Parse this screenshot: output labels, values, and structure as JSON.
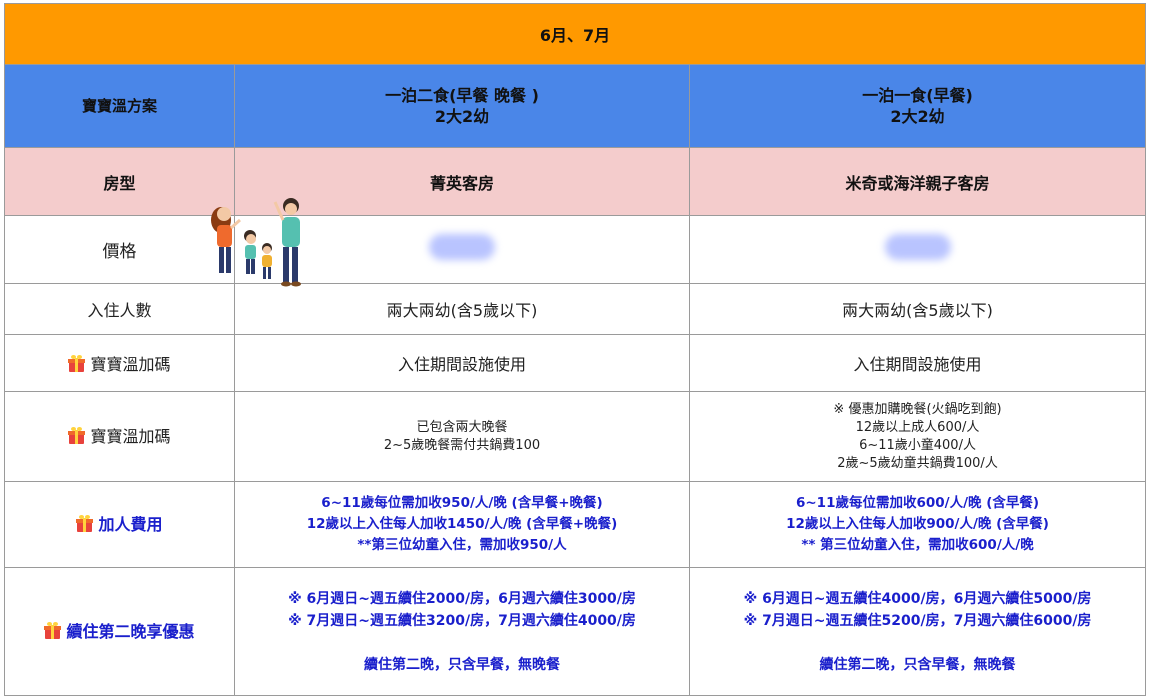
{
  "header": {
    "title": "6月、7月"
  },
  "plan_row": {
    "label": "寶寶溫方案",
    "col1": {
      "line1": "一泊二食(早餐 晚餐 )",
      "line2": "2大2幼"
    },
    "col2": {
      "line1": "一泊一食(早餐)",
      "line2": "2大2幼"
    }
  },
  "room_row": {
    "label": "房型",
    "col1": "菁英客房",
    "col2": "米奇或海洋親子客房"
  },
  "price_row": {
    "label": "價格",
    "col1_icon": "blurred-price",
    "col2_icon": "blurred-price"
  },
  "people_row": {
    "label": "入住人數",
    "col1": "兩大兩幼(含5歲以下)",
    "col2": "兩大兩幼(含5歲以下)"
  },
  "perk_row1": {
    "label": "寶寶溫加碼",
    "icon": "gift-icon",
    "col1": "入住期間設施使用",
    "col2": "入住期間設施使用"
  },
  "perk_row2": {
    "label": "寶寶溫加碼",
    "icon": "gift-icon",
    "col1": [
      "已包含兩大晚餐",
      "2~5歲晚餐需付共鍋費100"
    ],
    "col2": [
      "※ 優惠加購晚餐(火鍋吃到飽)",
      "12歲以上成人600/人",
      "6~11歲小童400/人",
      "2歲~5歲幼童共鍋費100/人"
    ]
  },
  "extra_row": {
    "label": "加人費用",
    "icon": "gift-icon",
    "col1": [
      "6~11歲每位需加收950/人/晚 (含早餐+晚餐)",
      "12歲以上入住每人加收1450/人/晚  (含早餐+晚餐)",
      "**第三位幼童入住，需加收950/人"
    ],
    "col2": [
      "6~11歲每位需加收600/人/晚 (含早餐)",
      "12歲以上入住每人加收900/人/晚 (含早餐)",
      "** 第三位幼童入住，需加收600/人/晚"
    ]
  },
  "stay_row": {
    "label": "續住第二晚享優惠",
    "icon": "gift-icon",
    "col1": [
      "※ 6月週日~週五續住2000/房，6月週六續住3000/房",
      "※ 7月週日~週五續住3200/房，7月週六續住4000/房",
      "",
      "續住第二晚，只含早餐，無晚餐"
    ],
    "col2": [
      "※ 6月週日~週五續住4000/房，6月週六續住5000/房",
      "※ 7月週日~週五續住5200/房，7月週六續住6000/房",
      "",
      "續住第二晚，只含早餐，無晚餐"
    ]
  },
  "colors": {
    "title_bg": "#ff9900",
    "plan_bg": "#4a86e8",
    "room_bg": "#f4cccc",
    "highlight_text": "#1a1fcc"
  },
  "decoration": {
    "icon": "family-illustration-icon"
  }
}
